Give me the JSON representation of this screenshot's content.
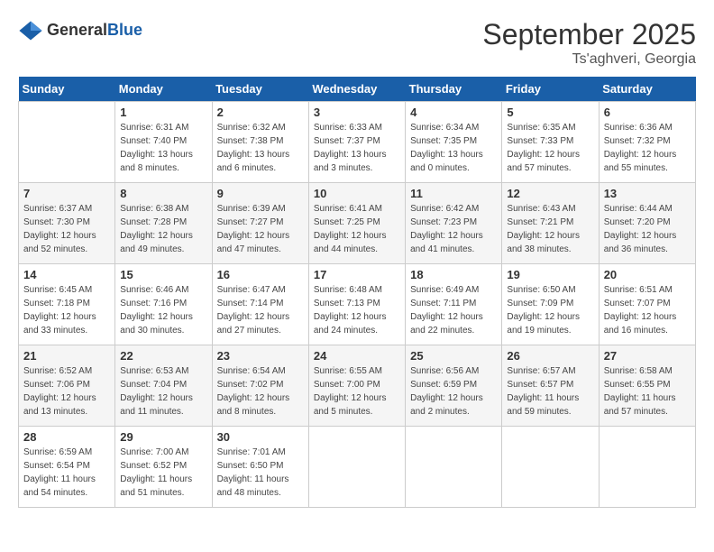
{
  "header": {
    "logo_general": "General",
    "logo_blue": "Blue",
    "month": "September 2025",
    "location": "Ts'aghveri, Georgia"
  },
  "weekdays": [
    "Sunday",
    "Monday",
    "Tuesday",
    "Wednesday",
    "Thursday",
    "Friday",
    "Saturday"
  ],
  "weeks": [
    [
      {
        "day": "",
        "sunrise": "",
        "sunset": "",
        "daylight": ""
      },
      {
        "day": "1",
        "sunrise": "Sunrise: 6:31 AM",
        "sunset": "Sunset: 7:40 PM",
        "daylight": "Daylight: 13 hours and 8 minutes."
      },
      {
        "day": "2",
        "sunrise": "Sunrise: 6:32 AM",
        "sunset": "Sunset: 7:38 PM",
        "daylight": "Daylight: 13 hours and 6 minutes."
      },
      {
        "day": "3",
        "sunrise": "Sunrise: 6:33 AM",
        "sunset": "Sunset: 7:37 PM",
        "daylight": "Daylight: 13 hours and 3 minutes."
      },
      {
        "day": "4",
        "sunrise": "Sunrise: 6:34 AM",
        "sunset": "Sunset: 7:35 PM",
        "daylight": "Daylight: 13 hours and 0 minutes."
      },
      {
        "day": "5",
        "sunrise": "Sunrise: 6:35 AM",
        "sunset": "Sunset: 7:33 PM",
        "daylight": "Daylight: 12 hours and 57 minutes."
      },
      {
        "day": "6",
        "sunrise": "Sunrise: 6:36 AM",
        "sunset": "Sunset: 7:32 PM",
        "daylight": "Daylight: 12 hours and 55 minutes."
      }
    ],
    [
      {
        "day": "7",
        "sunrise": "Sunrise: 6:37 AM",
        "sunset": "Sunset: 7:30 PM",
        "daylight": "Daylight: 12 hours and 52 minutes."
      },
      {
        "day": "8",
        "sunrise": "Sunrise: 6:38 AM",
        "sunset": "Sunset: 7:28 PM",
        "daylight": "Daylight: 12 hours and 49 minutes."
      },
      {
        "day": "9",
        "sunrise": "Sunrise: 6:39 AM",
        "sunset": "Sunset: 7:27 PM",
        "daylight": "Daylight: 12 hours and 47 minutes."
      },
      {
        "day": "10",
        "sunrise": "Sunrise: 6:41 AM",
        "sunset": "Sunset: 7:25 PM",
        "daylight": "Daylight: 12 hours and 44 minutes."
      },
      {
        "day": "11",
        "sunrise": "Sunrise: 6:42 AM",
        "sunset": "Sunset: 7:23 PM",
        "daylight": "Daylight: 12 hours and 41 minutes."
      },
      {
        "day": "12",
        "sunrise": "Sunrise: 6:43 AM",
        "sunset": "Sunset: 7:21 PM",
        "daylight": "Daylight: 12 hours and 38 minutes."
      },
      {
        "day": "13",
        "sunrise": "Sunrise: 6:44 AM",
        "sunset": "Sunset: 7:20 PM",
        "daylight": "Daylight: 12 hours and 36 minutes."
      }
    ],
    [
      {
        "day": "14",
        "sunrise": "Sunrise: 6:45 AM",
        "sunset": "Sunset: 7:18 PM",
        "daylight": "Daylight: 12 hours and 33 minutes."
      },
      {
        "day": "15",
        "sunrise": "Sunrise: 6:46 AM",
        "sunset": "Sunset: 7:16 PM",
        "daylight": "Daylight: 12 hours and 30 minutes."
      },
      {
        "day": "16",
        "sunrise": "Sunrise: 6:47 AM",
        "sunset": "Sunset: 7:14 PM",
        "daylight": "Daylight: 12 hours and 27 minutes."
      },
      {
        "day": "17",
        "sunrise": "Sunrise: 6:48 AM",
        "sunset": "Sunset: 7:13 PM",
        "daylight": "Daylight: 12 hours and 24 minutes."
      },
      {
        "day": "18",
        "sunrise": "Sunrise: 6:49 AM",
        "sunset": "Sunset: 7:11 PM",
        "daylight": "Daylight: 12 hours and 22 minutes."
      },
      {
        "day": "19",
        "sunrise": "Sunrise: 6:50 AM",
        "sunset": "Sunset: 7:09 PM",
        "daylight": "Daylight: 12 hours and 19 minutes."
      },
      {
        "day": "20",
        "sunrise": "Sunrise: 6:51 AM",
        "sunset": "Sunset: 7:07 PM",
        "daylight": "Daylight: 12 hours and 16 minutes."
      }
    ],
    [
      {
        "day": "21",
        "sunrise": "Sunrise: 6:52 AM",
        "sunset": "Sunset: 7:06 PM",
        "daylight": "Daylight: 12 hours and 13 minutes."
      },
      {
        "day": "22",
        "sunrise": "Sunrise: 6:53 AM",
        "sunset": "Sunset: 7:04 PM",
        "daylight": "Daylight: 12 hours and 11 minutes."
      },
      {
        "day": "23",
        "sunrise": "Sunrise: 6:54 AM",
        "sunset": "Sunset: 7:02 PM",
        "daylight": "Daylight: 12 hours and 8 minutes."
      },
      {
        "day": "24",
        "sunrise": "Sunrise: 6:55 AM",
        "sunset": "Sunset: 7:00 PM",
        "daylight": "Daylight: 12 hours and 5 minutes."
      },
      {
        "day": "25",
        "sunrise": "Sunrise: 6:56 AM",
        "sunset": "Sunset: 6:59 PM",
        "daylight": "Daylight: 12 hours and 2 minutes."
      },
      {
        "day": "26",
        "sunrise": "Sunrise: 6:57 AM",
        "sunset": "Sunset: 6:57 PM",
        "daylight": "Daylight: 11 hours and 59 minutes."
      },
      {
        "day": "27",
        "sunrise": "Sunrise: 6:58 AM",
        "sunset": "Sunset: 6:55 PM",
        "daylight": "Daylight: 11 hours and 57 minutes."
      }
    ],
    [
      {
        "day": "28",
        "sunrise": "Sunrise: 6:59 AM",
        "sunset": "Sunset: 6:54 PM",
        "daylight": "Daylight: 11 hours and 54 minutes."
      },
      {
        "day": "29",
        "sunrise": "Sunrise: 7:00 AM",
        "sunset": "Sunset: 6:52 PM",
        "daylight": "Daylight: 11 hours and 51 minutes."
      },
      {
        "day": "30",
        "sunrise": "Sunrise: 7:01 AM",
        "sunset": "Sunset: 6:50 PM",
        "daylight": "Daylight: 11 hours and 48 minutes."
      },
      {
        "day": "",
        "sunrise": "",
        "sunset": "",
        "daylight": ""
      },
      {
        "day": "",
        "sunrise": "",
        "sunset": "",
        "daylight": ""
      },
      {
        "day": "",
        "sunrise": "",
        "sunset": "",
        "daylight": ""
      },
      {
        "day": "",
        "sunrise": "",
        "sunset": "",
        "daylight": ""
      }
    ]
  ]
}
